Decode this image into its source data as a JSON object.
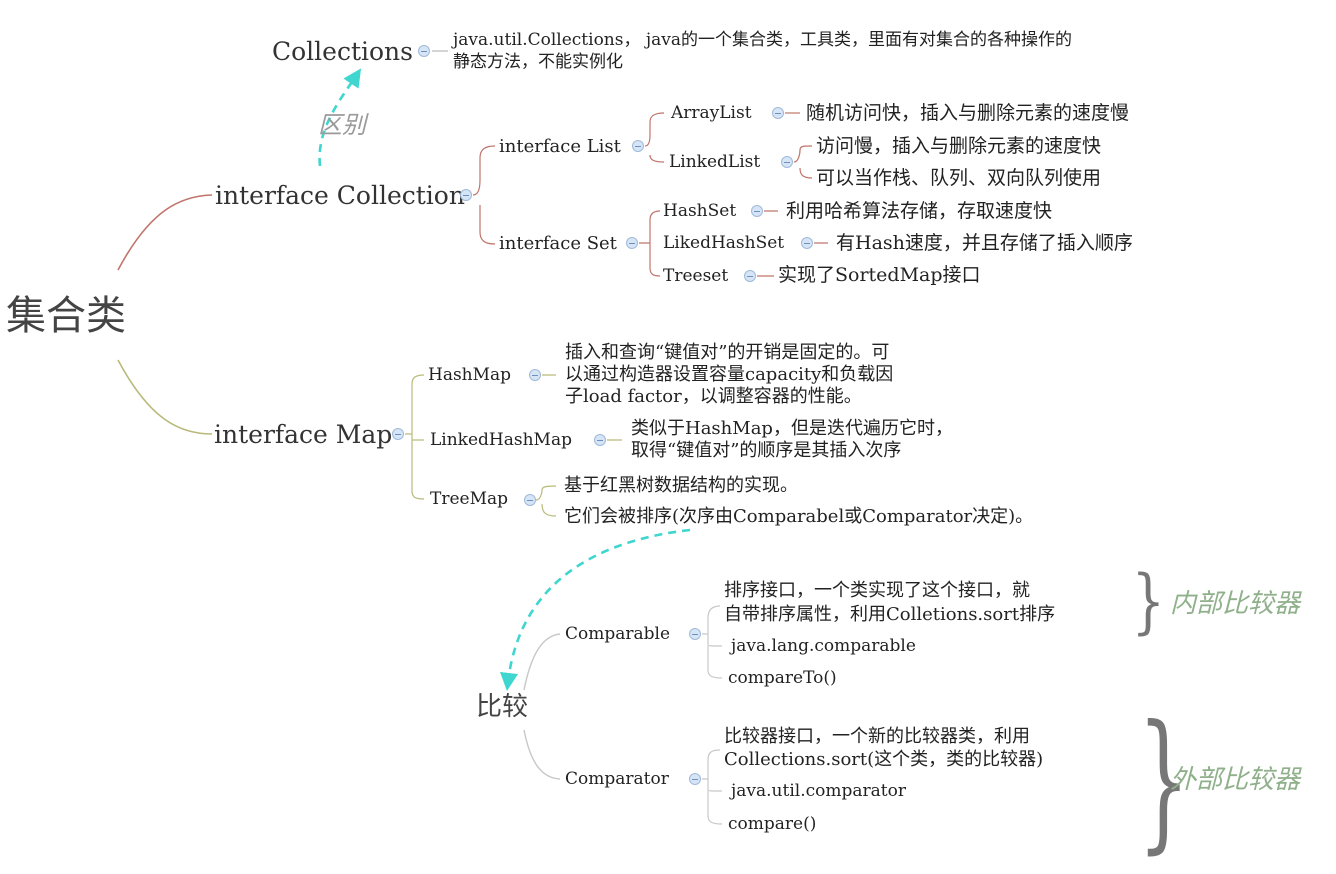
{
  "root": "集合类",
  "collections": {
    "title": "Collections",
    "desc_line1": "java.util.Collections， java的一个集合类，工具类，里面有对集合的各种操作的",
    "desc_line2": "静态方法，不能实例化"
  },
  "difference_label": "区别",
  "collection": {
    "title": "interface Collection",
    "list": {
      "title": "interface List",
      "arraylist": {
        "name": "ArrayList",
        "desc": "随机访问快，插入与删除元素的速度慢"
      },
      "linkedlist": {
        "name": "LinkedList",
        "desc1": "访问慢，插入与删除元素的速度快",
        "desc2": "可以当作栈、队列、双向队列使用"
      }
    },
    "set": {
      "title": "interface Set",
      "hashset": {
        "name": "HashSet",
        "desc": "利用哈希算法存储，存取速度快"
      },
      "likedhashset": {
        "name": "LikedHashSet",
        "desc": "有Hash速度，并且存储了插入顺序"
      },
      "treeset": {
        "name": "Treeset",
        "desc": "实现了SortedMap接口"
      }
    }
  },
  "map": {
    "title": "interface Map",
    "hashmap": {
      "name": "HashMap",
      "desc1": "插入和查询“键值对”的开销是固定的。可",
      "desc2": "以通过构造器设置容量capacity和负载因",
      "desc3": "子load factor，以调整容器的性能。"
    },
    "linkedhashmap": {
      "name": "LinkedHashMap",
      "desc1": "类似于HashMap，但是迭代遍历它时，",
      "desc2": "取得“键值对”的顺序是其插入次序"
    },
    "treemap": {
      "name": "TreeMap",
      "desc1": "基于红黑树数据结构的实现。",
      "desc2": "它们会被排序(次序由Comparabel或Comparator决定)。"
    }
  },
  "compare": {
    "title": "比较",
    "comparable": {
      "name": "Comparable",
      "desc1": "排序接口，一个类实现了这个接口，就",
      "desc2": "自带排序属性，利用Colletions.sort排序",
      "pkg": "java.lang.comparable",
      "method": "compareTo()"
    },
    "comparator": {
      "name": "Comparator",
      "desc1": "比较器接口，一个新的比较器类，利用",
      "desc2": "Collections.sort(这个类，类的比较器)",
      "pkg": "java.util.comparator",
      "method": "compare()"
    },
    "internal_label": "内部比较器",
    "external_label": "外部比较器"
  },
  "colors": {
    "collection_branch": "#c0746a",
    "map_branch": "#b9b97a",
    "compare_branch": "#c8c8c8",
    "relation_arrow": "#3fd6d0",
    "toggle_fill": "#d6e5f6",
    "note_green": "#8fb08a"
  },
  "icons": {
    "toggle": "collapse-minus-icon"
  }
}
